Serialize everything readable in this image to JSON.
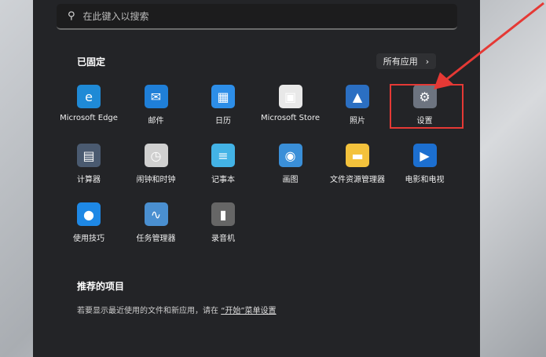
{
  "search": {
    "placeholder": "在此键入以搜索",
    "icon": "search-icon"
  },
  "pinned": {
    "title": "已固定",
    "all_apps": "所有应用",
    "apps": [
      {
        "label": "Microsoft Edge",
        "color": "#1f8ad6"
      },
      {
        "label": "邮件",
        "color": "#1f7fd8"
      },
      {
        "label": "日历",
        "color": "#2d8ee8"
      },
      {
        "label": "Microsoft Store",
        "color": "#e8e8e8"
      },
      {
        "label": "照片",
        "color": "#2b6fc2"
      },
      {
        "label": "设置",
        "color": "#6d7480"
      },
      {
        "label": "计算器",
        "color": "#4a5a70"
      },
      {
        "label": "闹钟和时钟",
        "color": "#d0d0d0"
      },
      {
        "label": "记事本",
        "color": "#43b3e6"
      },
      {
        "label": "画图",
        "color": "#3a8fd8"
      },
      {
        "label": "文件资源管理器",
        "color": "#f3c23c"
      },
      {
        "label": "电影和电视",
        "color": "#1c6fd0"
      },
      {
        "label": "使用技巧",
        "color": "#1e88e5"
      },
      {
        "label": "任务管理器",
        "color": "#4a8fd0"
      },
      {
        "label": "录音机",
        "color": "#666"
      }
    ]
  },
  "recommended": {
    "title": "推荐的项目",
    "text": "若要显示最近使用的文件和新应用，请在",
    "link": "“开始”菜单设置"
  },
  "annotation_color": "#e53935"
}
